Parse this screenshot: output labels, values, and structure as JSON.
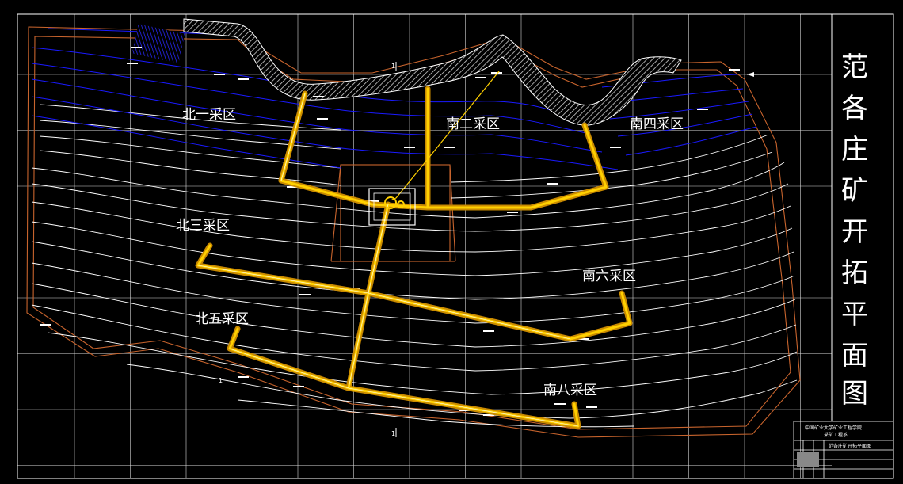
{
  "drawing": {
    "title": "范各庄矿开拓平面图",
    "title_chars": [
      "范",
      "各",
      "庄",
      "矿",
      "开",
      "拓",
      "平",
      "面",
      "图"
    ],
    "zones": {
      "bei1": "北一采区",
      "nan2": "南二采区",
      "nan4": "南四采区",
      "bei3": "北三采区",
      "nan6": "南六采区",
      "bei5": "北五采区",
      "nan8": "南八采区"
    },
    "section_marks": {
      "top": "1",
      "left": "1",
      "bottom": "1"
    },
    "title_block": {
      "institution": "中国矿业大学矿业工程学院",
      "department": "采矿工程系",
      "drawing_name": "范各庄矿开拓平面图"
    }
  },
  "colors": {
    "background": "#000000",
    "grid": "#ffffff",
    "contour": "#ffffff",
    "blue_contour": "#1a1aff",
    "roadway_outline": "#ffb300",
    "roadway_fill": "#ffd000",
    "boundary": "#c8642d",
    "hatch": "#bfbfbf"
  }
}
